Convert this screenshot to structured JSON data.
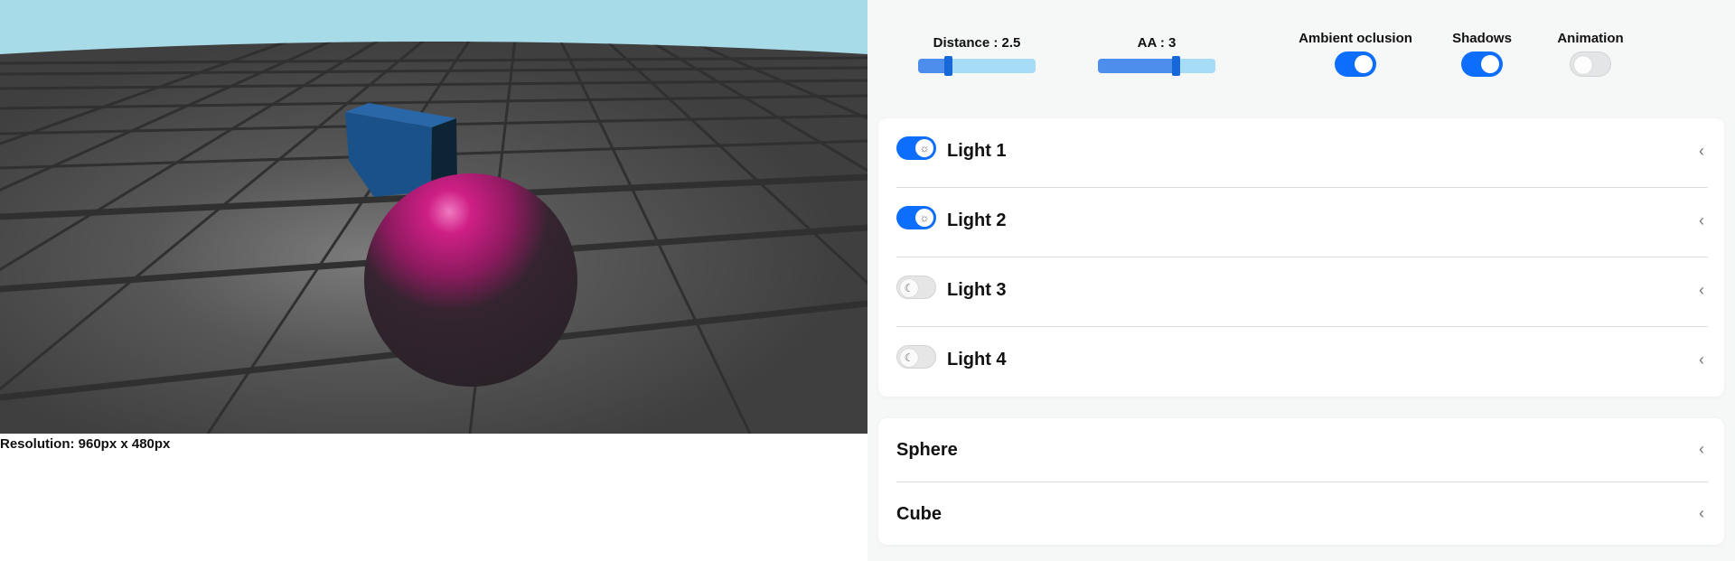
{
  "viewport": {
    "resolution_text": "Resolution: 960px x 480px",
    "colors": {
      "sky": "#a8dbe8",
      "floor": "#4a4a4a",
      "grid": "#323232",
      "cube": "#1a5188",
      "sphere": "#d0147f"
    }
  },
  "controls": {
    "distance": {
      "label": "Distance : 2.5",
      "value": 2.5,
      "fill_fraction": 0.26
    },
    "aa": {
      "label": "AA : 3",
      "value": 3,
      "fill_fraction": 0.67
    },
    "ambient_occlusion": {
      "label": "Ambient oclusion",
      "on": true
    },
    "shadows": {
      "label": "Shadows",
      "on": true
    },
    "animation": {
      "label": "Animation",
      "on": false
    }
  },
  "lights": [
    {
      "label": "Light 1",
      "on": true,
      "icon": "sun-icon"
    },
    {
      "label": "Light 2",
      "on": true,
      "icon": "sun-icon"
    },
    {
      "label": "Light 3",
      "on": false,
      "icon": "moon-icon"
    },
    {
      "label": "Light 4",
      "on": false,
      "icon": "moon-icon"
    }
  ],
  "objects": [
    {
      "label": "Sphere"
    },
    {
      "label": "Cube"
    }
  ],
  "accent": "#0d6efd"
}
